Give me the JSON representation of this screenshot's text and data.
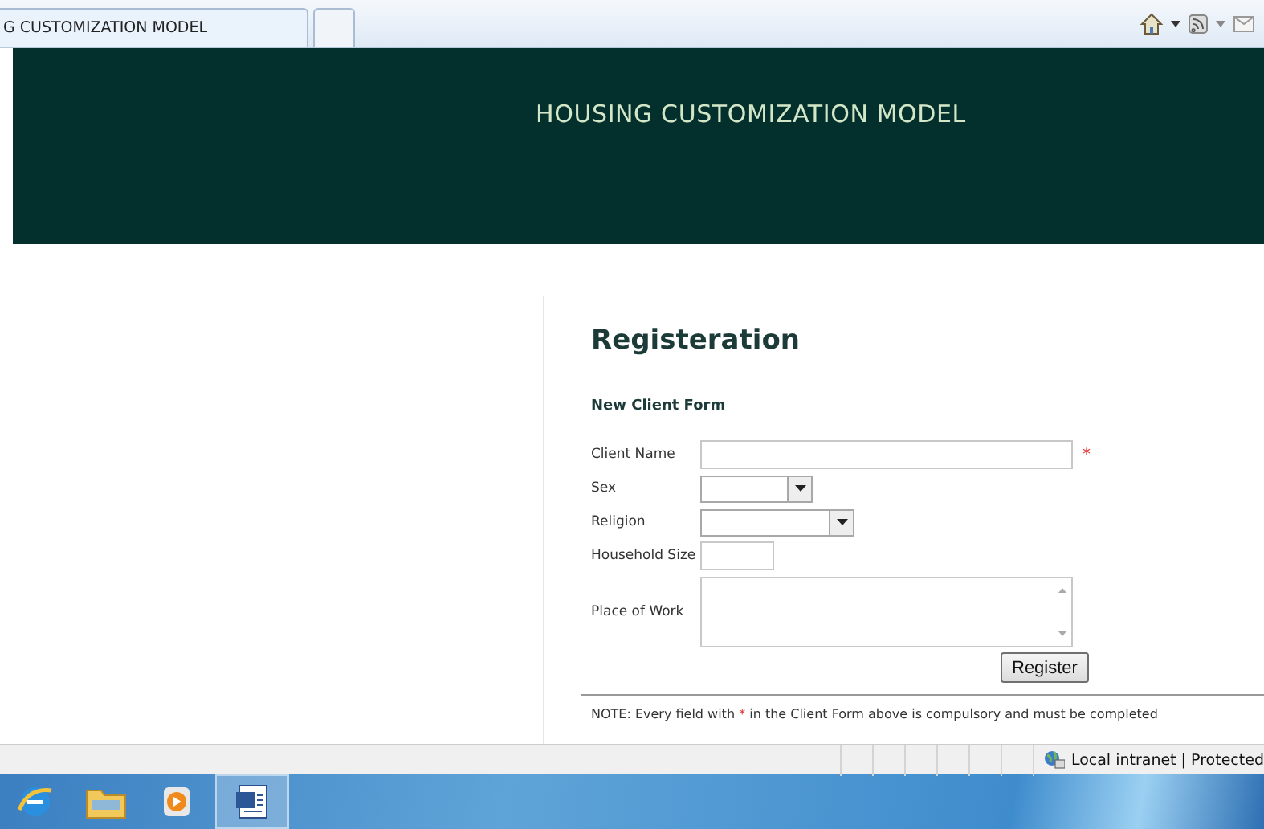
{
  "browser": {
    "tab_title": "G CUSTOMIZATION MODEL"
  },
  "header": {
    "title": "HOUSING CUSTOMIZATION MODEL"
  },
  "page": {
    "heading": "Registeration",
    "form_title": "New Client Form",
    "fields": [
      {
        "label": "Client Name",
        "kind": "text",
        "required": true
      },
      {
        "label": "Sex",
        "kind": "select",
        "required": false
      },
      {
        "label": "Religion",
        "kind": "select",
        "required": false
      },
      {
        "label": "Household Size",
        "kind": "short",
        "required": false
      },
      {
        "label": "Place of Work",
        "kind": "textarea",
        "required": false
      }
    ],
    "required_mark": "*",
    "submit": "Register",
    "note": {
      "before": "NOTE: Every field with",
      "mark": "*",
      "after": "in the Client Form above is compulsory and must be completed"
    }
  },
  "status_bar": {
    "zone": "Local intranet | Protected"
  }
}
